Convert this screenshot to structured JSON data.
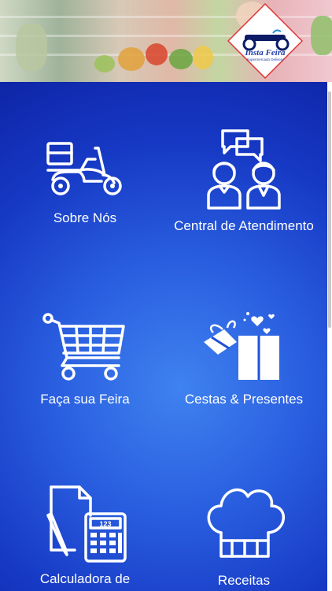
{
  "header": {
    "logo_text": "Insta Feira",
    "logo_subtext": "Supermercado Delivery"
  },
  "menu": {
    "items": [
      {
        "label": "Sobre Nós",
        "icon": "delivery-scooter-icon"
      },
      {
        "label": "Central de Atendimento",
        "icon": "customer-service-icon"
      },
      {
        "label": "Faça sua Feira",
        "icon": "shopping-cart-icon"
      },
      {
        "label": "Cestas & Presentes",
        "icon": "gift-box-icon"
      },
      {
        "label": "Calculadora de",
        "icon": "calculator-icon"
      },
      {
        "label": "Receitas",
        "icon": "chef-hat-icon"
      }
    ]
  },
  "calculator_display": "123",
  "colors": {
    "primary_blue": "#1a3bc4",
    "accent_blue": "#3f82f0",
    "icon_white": "#ffffff"
  }
}
